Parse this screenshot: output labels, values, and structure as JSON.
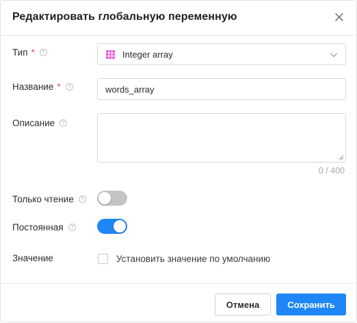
{
  "dialog": {
    "title": "Редактировать глобальную переменную",
    "close_icon": "close-icon"
  },
  "fields": {
    "type": {
      "label": "Тип",
      "required_mark": "*",
      "help_icon": "question-circle-icon",
      "value": "Integer array",
      "value_icon": "grid-icon",
      "value_icon_color": "#e65ad6"
    },
    "name": {
      "label": "Название",
      "required_mark": "*",
      "help_icon": "question-circle-icon",
      "value": "words_array"
    },
    "description": {
      "label": "Описание",
      "help_icon": "question-circle-icon",
      "value": "",
      "counter": "0 / 400"
    },
    "readonly": {
      "label": "Только чтение",
      "help_icon": "question-circle-icon",
      "checked": false
    },
    "constant": {
      "label": "Постоянная",
      "help_icon": "question-circle-icon",
      "checked": true
    },
    "value": {
      "label": "Значение",
      "checkbox_label": "Установить значение по умолчанию",
      "checked": false
    }
  },
  "footer": {
    "cancel_label": "Отмена",
    "save_label": "Сохранить"
  },
  "colors": {
    "accent": "#1f87f5",
    "required": "#e5484d",
    "toggle_off": "#c4c4c4"
  }
}
